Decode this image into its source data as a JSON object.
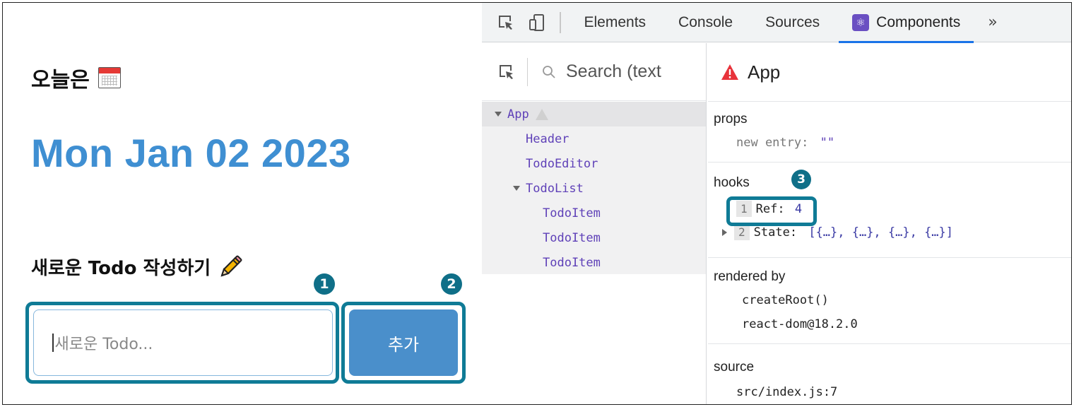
{
  "app": {
    "today_label": "오늘은",
    "date": "Mon Jan 02 2023",
    "editor_title": "새로운 Todo 작성하기",
    "input_placeholder": "새로운 Todo...",
    "add_button": "추가"
  },
  "annotations": {
    "badge1": "1",
    "badge2": "2",
    "badge3": "3",
    "highlight_color": "#0f7b96"
  },
  "devtools": {
    "tabs": [
      "Elements",
      "Console",
      "Sources",
      "Components"
    ],
    "active_tab": "Components",
    "more": "»",
    "search_placeholder": "Search (text",
    "tree": [
      {
        "label": "App",
        "depth": 0,
        "expanded": true,
        "warning": true,
        "selected": true
      },
      {
        "label": "Header",
        "depth": 1
      },
      {
        "label": "TodoEditor",
        "depth": 1
      },
      {
        "label": "TodoList",
        "depth": 1,
        "expanded": true
      },
      {
        "label": "TodoItem",
        "depth": 2
      },
      {
        "label": "TodoItem",
        "depth": 2
      },
      {
        "label": "TodoItem",
        "depth": 2
      }
    ],
    "selected_component": "App",
    "props_title": "props",
    "props": [
      {
        "key": "new entry:",
        "value": "\"\""
      }
    ],
    "hooks_title": "hooks",
    "hooks": [
      {
        "index": "1",
        "key": "Ref:",
        "value": "4"
      },
      {
        "index": "2",
        "key": "State:",
        "value": "[{…}, {…}, {…}, {…}]"
      }
    ],
    "rendered_by_title": "rendered by",
    "rendered_by": [
      "createRoot()",
      "react-dom@18.2.0"
    ],
    "source_title": "source",
    "source": "src/index.js:7"
  },
  "colors": {
    "date": "#3f8fd2",
    "button": "#4a8fcb",
    "component_name": "#5f41b8",
    "active_tab_underline": "#1a73e8"
  }
}
